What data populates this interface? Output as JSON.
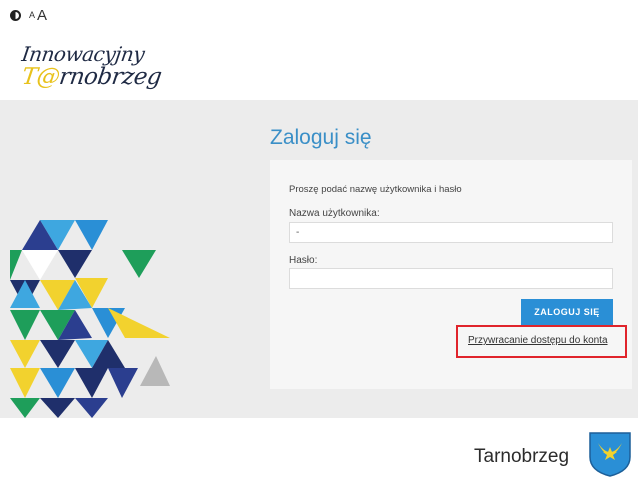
{
  "accessibility": {
    "contrast_icon": "contrast-icon",
    "font_small_label": "A",
    "font_large_label": "A"
  },
  "logo": {
    "line1": "Innowacyjny",
    "line2_at": "T@",
    "line2_rest": "rnobrzeg"
  },
  "login": {
    "title": "Zaloguj się",
    "instruction": "Proszę podać nazwę użytkownika i hasło",
    "username_label": "Nazwa użytkownika:",
    "username_value": "-",
    "password_label": "Hasło:",
    "password_value": "",
    "submit_label": "ZALOGUJ SIĘ",
    "recover_link": "Przywracanie dostępu do konta"
  },
  "footer": {
    "city_name": "Tarnobrzeg",
    "crest_icon": "city-crest-icon"
  },
  "colors": {
    "accent_blue": "#2a8fd6",
    "title_blue": "#3a8fc7",
    "highlight_red": "#e0242b",
    "deco_yellow": "#f2d22e",
    "deco_green": "#1e9e5a",
    "deco_navy": "#1f2f6b",
    "deco_light_blue": "#3ea7e0"
  }
}
